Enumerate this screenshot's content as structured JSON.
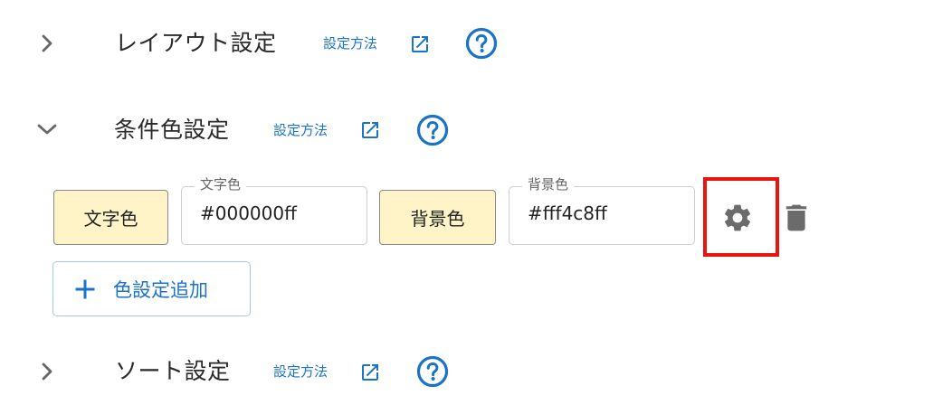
{
  "sections": [
    {
      "title": "レイアウト設定",
      "howto_label": "設定方法",
      "expanded": false
    },
    {
      "title": "条件色設定",
      "howto_label": "設定方法",
      "expanded": true
    },
    {
      "title": "ソート設定",
      "howto_label": "設定方法",
      "expanded": false
    }
  ],
  "condition_row": {
    "text_color_button": "文字色",
    "text_color_field_label": "文字色",
    "text_color_value": "#000000ff",
    "bg_color_button": "背景色",
    "bg_color_field_label": "背景色",
    "bg_color_value": "#fff4c8ff",
    "settings_icon": "gear-icon",
    "delete_icon": "trash-icon"
  },
  "add_button": {
    "label": "色設定追加",
    "icon": "plus-icon"
  },
  "colors": {
    "link": "#1a73c8",
    "swatch_bg": "#fff4c8",
    "highlight": "#e8140f",
    "icon_gray": "#6b6b6b"
  }
}
